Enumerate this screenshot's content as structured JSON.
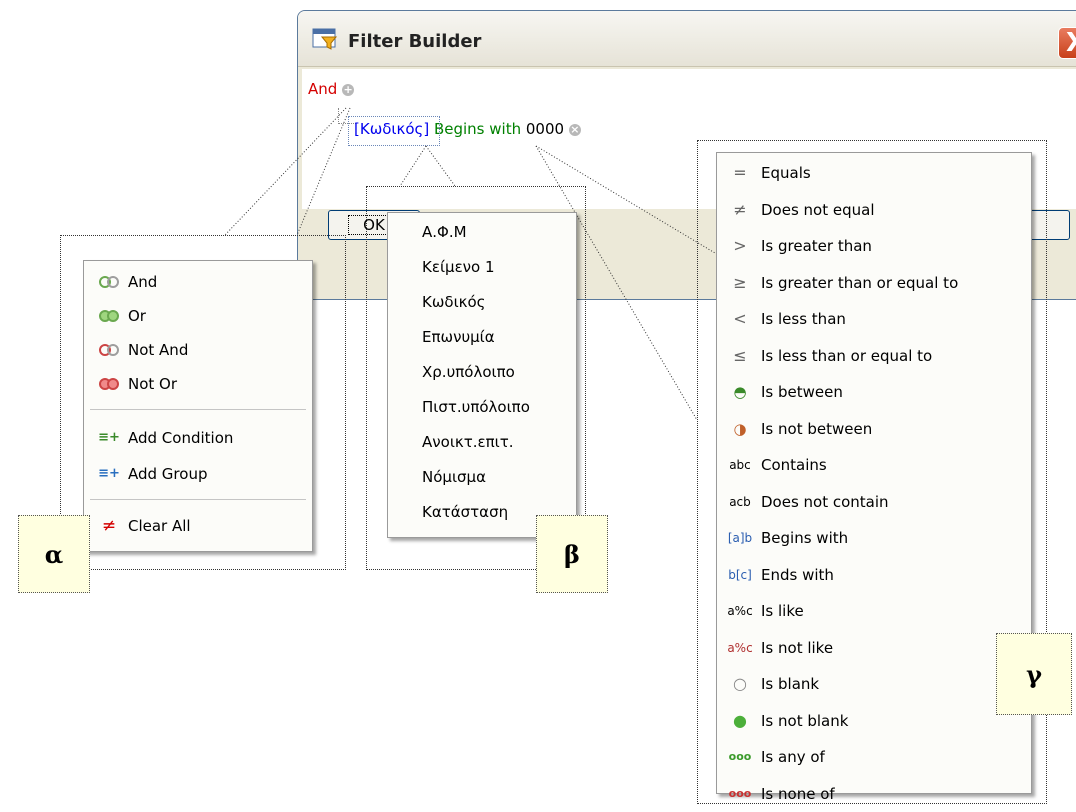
{
  "dialog": {
    "title": "Filter Builder",
    "close_glyph": "X",
    "ok_label": "OK",
    "root_group": "And",
    "condition": {
      "field": "[Κωδικός]",
      "operator": "Begins with",
      "value": "0000"
    }
  },
  "menu_alpha": {
    "groups": [
      {
        "label": "And",
        "icon": "and-rings-icon"
      },
      {
        "label": "Or",
        "icon": "or-rings-icon"
      },
      {
        "label": "Not And",
        "icon": "not-and-rings-icon"
      },
      {
        "label": "Not Or",
        "icon": "not-or-rings-icon"
      }
    ],
    "actions": [
      {
        "label": "Add Condition",
        "icon": "add-condition-icon"
      },
      {
        "label": "Add Group",
        "icon": "add-group-icon"
      }
    ],
    "clear": {
      "label": "Clear All",
      "icon": "clear-all-icon"
    }
  },
  "menu_beta": {
    "fields": [
      "Α.Φ.Μ",
      "Κείμενο 1",
      "Κωδικός",
      "Επωνυμία",
      "Χρ.υπόλοιπο",
      "Πιστ.υπόλοιπο",
      "Ανοικτ.επιτ.",
      "Νόμισμα",
      "Κατάσταση"
    ]
  },
  "menu_gamma": {
    "operators": [
      {
        "label": "Equals",
        "icon": "="
      },
      {
        "label": "Does not equal",
        "icon": "≠"
      },
      {
        "label": "Is greater than",
        "icon": ">"
      },
      {
        "label": "Is greater than or equal to",
        "icon": "≥"
      },
      {
        "label": "Is less than",
        "icon": "<"
      },
      {
        "label": "Is less than or equal to",
        "icon": "≤"
      },
      {
        "label": "Is between",
        "icon": "◓"
      },
      {
        "label": "Is not between",
        "icon": "◑"
      },
      {
        "label": "Contains",
        "icon": "abc"
      },
      {
        "label": "Does not contain",
        "icon": "acb"
      },
      {
        "label": "Begins with",
        "icon": "[a]b"
      },
      {
        "label": "Ends with",
        "icon": "b[c]"
      },
      {
        "label": "Is like",
        "icon": "a%c"
      },
      {
        "label": "Is not like",
        "icon": "a%c"
      },
      {
        "label": "Is blank",
        "icon": "○"
      },
      {
        "label": "Is not blank",
        "icon": "●"
      },
      {
        "label": "Is any of",
        "icon": "ooo"
      },
      {
        "label": "Is none of",
        "icon": "ooo"
      }
    ]
  },
  "tags": {
    "alpha": "α",
    "beta": "β",
    "gamma": "γ"
  },
  "colors": {
    "group": "#d40000",
    "field": "#0000ee",
    "operator": "#008000",
    "value": "#000000"
  }
}
